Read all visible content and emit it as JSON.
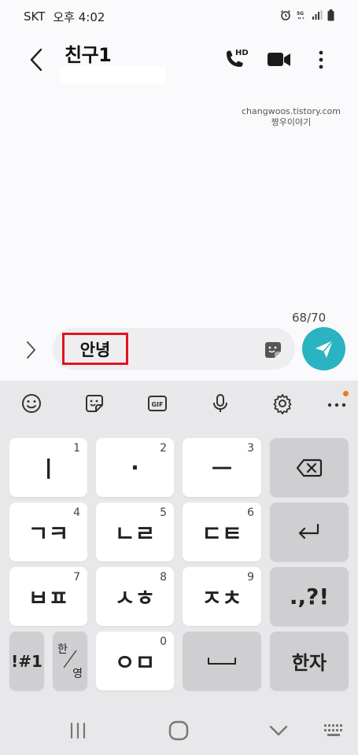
{
  "status": {
    "carrier": "SKT",
    "time": "오후 4:02"
  },
  "header": {
    "contact_name": "친구1",
    "hd_badge": "HD"
  },
  "watermark": {
    "line1": "changwoos.tistory.com",
    "line2": "짱우이야기"
  },
  "compose": {
    "counter": "68/70",
    "message_text": "안녕"
  },
  "keyboard": {
    "toolbar": {
      "gif_label": "GIF"
    },
    "rows": [
      [
        {
          "label": "ㅣ",
          "num": "1"
        },
        {
          "label": "·",
          "num": "2"
        },
        {
          "label": "ㅡ",
          "num": "3"
        }
      ],
      [
        {
          "label": "ㄱㅋ",
          "num": "4"
        },
        {
          "label": "ㄴㄹ",
          "num": "5"
        },
        {
          "label": "ㄷㅌ",
          "num": "6"
        }
      ],
      [
        {
          "label": "ㅂㅍ",
          "num": "7"
        },
        {
          "label": "ㅅㅎ",
          "num": "8"
        },
        {
          "label": "ㅈㅊ",
          "num": "9"
        }
      ]
    ],
    "punct_label": ".,?!",
    "symbols_label": "!#1",
    "lang_han": "한",
    "lang_eng": "영",
    "om_label": "ㅇㅁ",
    "om_num": "0",
    "hanja_label": "한자"
  },
  "colors": {
    "accent": "#2ab3c0",
    "highlight": "#e1141b",
    "notify_dot": "#f07a1e"
  }
}
